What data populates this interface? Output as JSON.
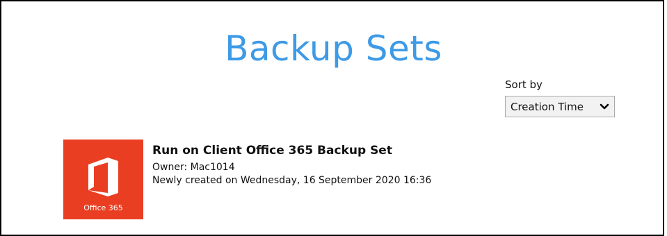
{
  "page": {
    "title": "Backup Sets"
  },
  "sort": {
    "label": "Sort by",
    "selected": "Creation Time",
    "chevron_icon": "chevron-down-icon"
  },
  "backup_sets": [
    {
      "name": "Run on Client Office 365 Backup Set",
      "owner": "Owner: Mac1014",
      "created": "Newly created on Wednesday, 16 September 2020 16:36",
      "icon": "office365-icon",
      "icon_caption": "Office 365",
      "icon_color": "#ea3e23"
    }
  ],
  "colors": {
    "title": "#3d9ae6",
    "border": "#000000"
  }
}
